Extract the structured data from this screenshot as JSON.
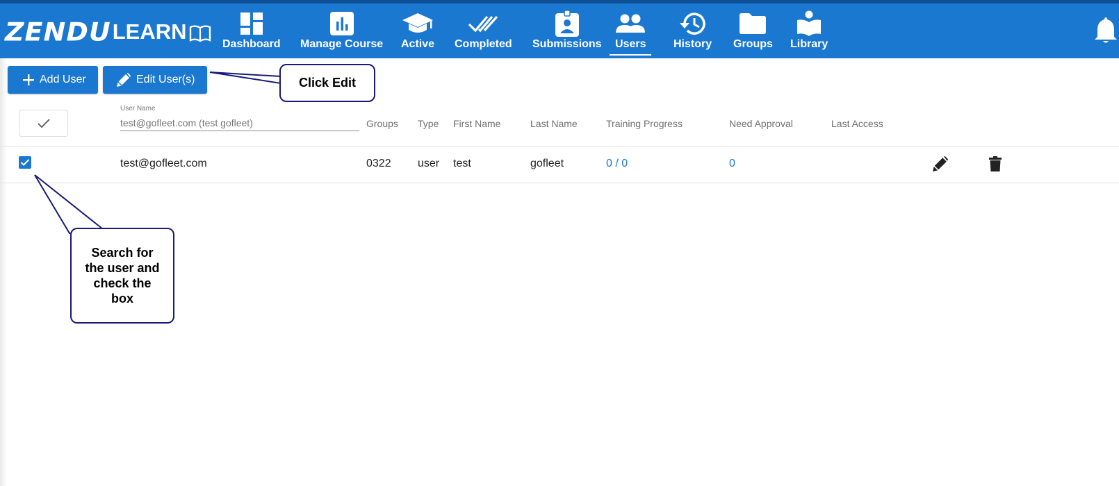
{
  "brand": {
    "logo_main": "ZENDU",
    "logo_sub": "LEARN"
  },
  "nav": {
    "items": [
      {
        "label": "Dashboard",
        "icon": "dashboard-icon"
      },
      {
        "label": "Manage Course",
        "icon": "bar-chart-icon"
      },
      {
        "label": "Active",
        "icon": "graduation-cap-icon"
      },
      {
        "label": "Completed",
        "icon": "double-check-icon"
      },
      {
        "label": "Submissions",
        "icon": "badge-icon"
      },
      {
        "label": "Users",
        "icon": "users-icon",
        "active": true
      },
      {
        "label": "History",
        "icon": "history-icon"
      },
      {
        "label": "Groups",
        "icon": "folder-icon"
      },
      {
        "label": "Library",
        "icon": "reading-book-icon"
      }
    ],
    "notifications_icon": "bell-icon"
  },
  "toolbar": {
    "add_user_label": "Add User",
    "edit_users_label": "Edit User(s)"
  },
  "filter": {
    "label": "User Name",
    "placeholder": "test@gofleet.com (test gofleet)"
  },
  "table": {
    "headers": [
      "Groups",
      "Type",
      "First Name",
      "Last Name",
      "Training Progress",
      "Need Approval",
      "Last Access"
    ],
    "rows": [
      {
        "checked": true,
        "user_name": "test@gofleet.com",
        "groups": "0322",
        "type": "user",
        "first_name": "test",
        "last_name": "gofleet",
        "training_progress": "0 / 0",
        "need_approval": "0",
        "last_access": ""
      }
    ]
  },
  "callouts": {
    "edit": "Click Edit",
    "search_lines": [
      "Search for",
      "the user and",
      "check the",
      "box"
    ]
  },
  "colors": {
    "primary": "#1b78d0",
    "header_dark": "#0f4f96",
    "callout_border": "#1a1a7a"
  }
}
